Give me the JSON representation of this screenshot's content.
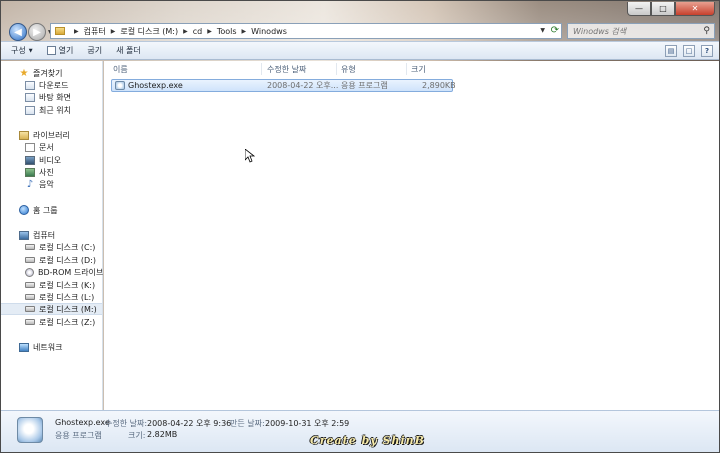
{
  "window": {
    "controls": {
      "minimize": "—",
      "maximize": "□",
      "close": "✕"
    }
  },
  "address_bar": {
    "segments": [
      "컴퓨터",
      "로컬 디스크 (M:)",
      "cd",
      "Tools",
      "Winodws"
    ]
  },
  "search": {
    "placeholder": "Winodws 검색"
  },
  "toolbar": {
    "organize": "구성",
    "open": "열기",
    "burn": "굽기",
    "new_folder": "새 폴더"
  },
  "nav_pane": {
    "favorites": "즐겨찾기",
    "downloads": "다운로드",
    "desktop": "바탕 화면",
    "recent": "최근 위치",
    "libraries": "라이브러리",
    "documents": "문서",
    "videos": "비디오",
    "pictures": "사진",
    "music": "음악",
    "homegroup": "홈 그룹",
    "computer": "컴퓨터",
    "drives": [
      "로컬 디스크 (C:)",
      "로컬 디스크 (D:)",
      "BD-ROM 드라이브 (",
      "로컬 디스크 (K:)",
      "로컬 디스크 (L:)",
      "로컬 디스크 (M:)",
      "로컬 디스크 (Z:)"
    ],
    "network": "네트워크"
  },
  "columns": {
    "name": "이름",
    "modified": "수정한 날짜",
    "type": "유형",
    "size": "크기"
  },
  "files": [
    {
      "name": "Ghostexp.exe",
      "modified": "2008-04-22 오후...",
      "type": "응용 프로그램",
      "size": "2,890KB"
    }
  ],
  "details": {
    "name": "Ghostexp.exe",
    "type": "응용 프로그램",
    "modified_label": "수정한 날짜:",
    "modified_value": "2008-04-22 오후 9:36",
    "created_label": "만든 날짜:",
    "created_value": "2009-10-31 오후 2:59",
    "size_label": "크기:",
    "size_value": "2.82MB"
  },
  "watermark": "Create by ShinB",
  "colors": {
    "selection": "#cfe3fb",
    "selection_border": "#84acdd",
    "toolbar": "#dde7f3",
    "accent": "#2c6fc4"
  }
}
